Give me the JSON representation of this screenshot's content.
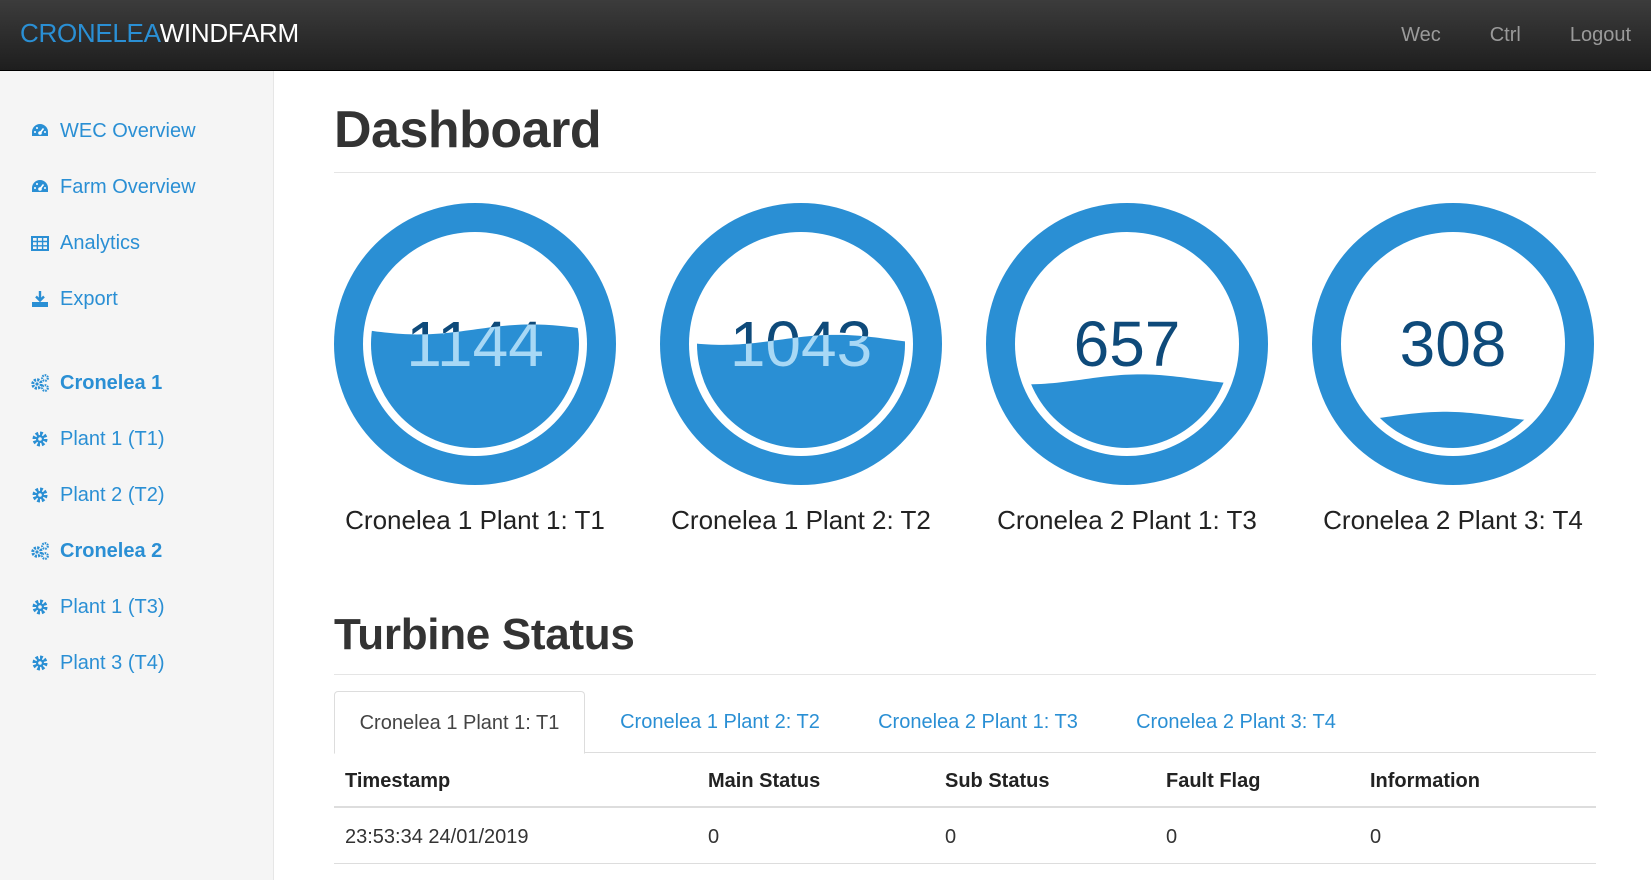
{
  "brand": {
    "part1": "CRONELEA",
    "part2": "WINDFARM"
  },
  "nav": [
    "Wec",
    "Ctrl",
    "Logout"
  ],
  "sidebar": {
    "items": [
      {
        "label": "WEC Overview",
        "icon": "dashboard-icon"
      },
      {
        "label": "Farm Overview",
        "icon": "dashboard-icon"
      },
      {
        "label": "Analytics",
        "icon": "table-icon"
      },
      {
        "label": "Export",
        "icon": "download-icon"
      },
      {
        "label": "Cronelea 1",
        "icon": "gears-icon"
      },
      {
        "label": "Plant 1 (T1)",
        "icon": "gear-icon"
      },
      {
        "label": "Plant 2 (T2)",
        "icon": "gear-icon"
      },
      {
        "label": "Cronelea 2",
        "icon": "gears-icon"
      },
      {
        "label": "Plant 1 (T3)",
        "icon": "gear-icon"
      },
      {
        "label": "Plant 3 (T4)",
        "icon": "gear-icon"
      }
    ]
  },
  "main": {
    "title": "Dashboard",
    "gauges": [
      {
        "value": "1144",
        "label": "Cronelea 1 Plant 1: T1",
        "fill": 0.57
      },
      {
        "value": "1043",
        "label": "Cronelea 1 Plant 2: T2",
        "fill": 0.52
      },
      {
        "value": "657",
        "label": "Cronelea 2 Plant 1: T3",
        "fill": 0.33
      },
      {
        "value": "308",
        "label": "Cronelea 2 Plant 3: T4",
        "fill": 0.15
      }
    ],
    "status_title": "Turbine Status",
    "tabs": [
      "Cronelea 1 Plant 1: T1",
      "Cronelea 1 Plant 2: T2",
      "Cronelea 2 Plant 1: T3",
      "Cronelea 2 Plant 3: T4"
    ],
    "active_tab": 0,
    "table": {
      "headers": [
        "Timestamp",
        "Main Status",
        "Sub Status",
        "Fault Flag",
        "Information"
      ],
      "rows": [
        [
          "23:53:34 24/01/2019",
          "0",
          "0",
          "0",
          "0"
        ]
      ]
    }
  },
  "colors": {
    "accent": "#2a8fd4",
    "gauge_text": "#0e4a7a",
    "navbar": "#2b2b2b",
    "sidebar_bg": "#f5f5f5"
  }
}
